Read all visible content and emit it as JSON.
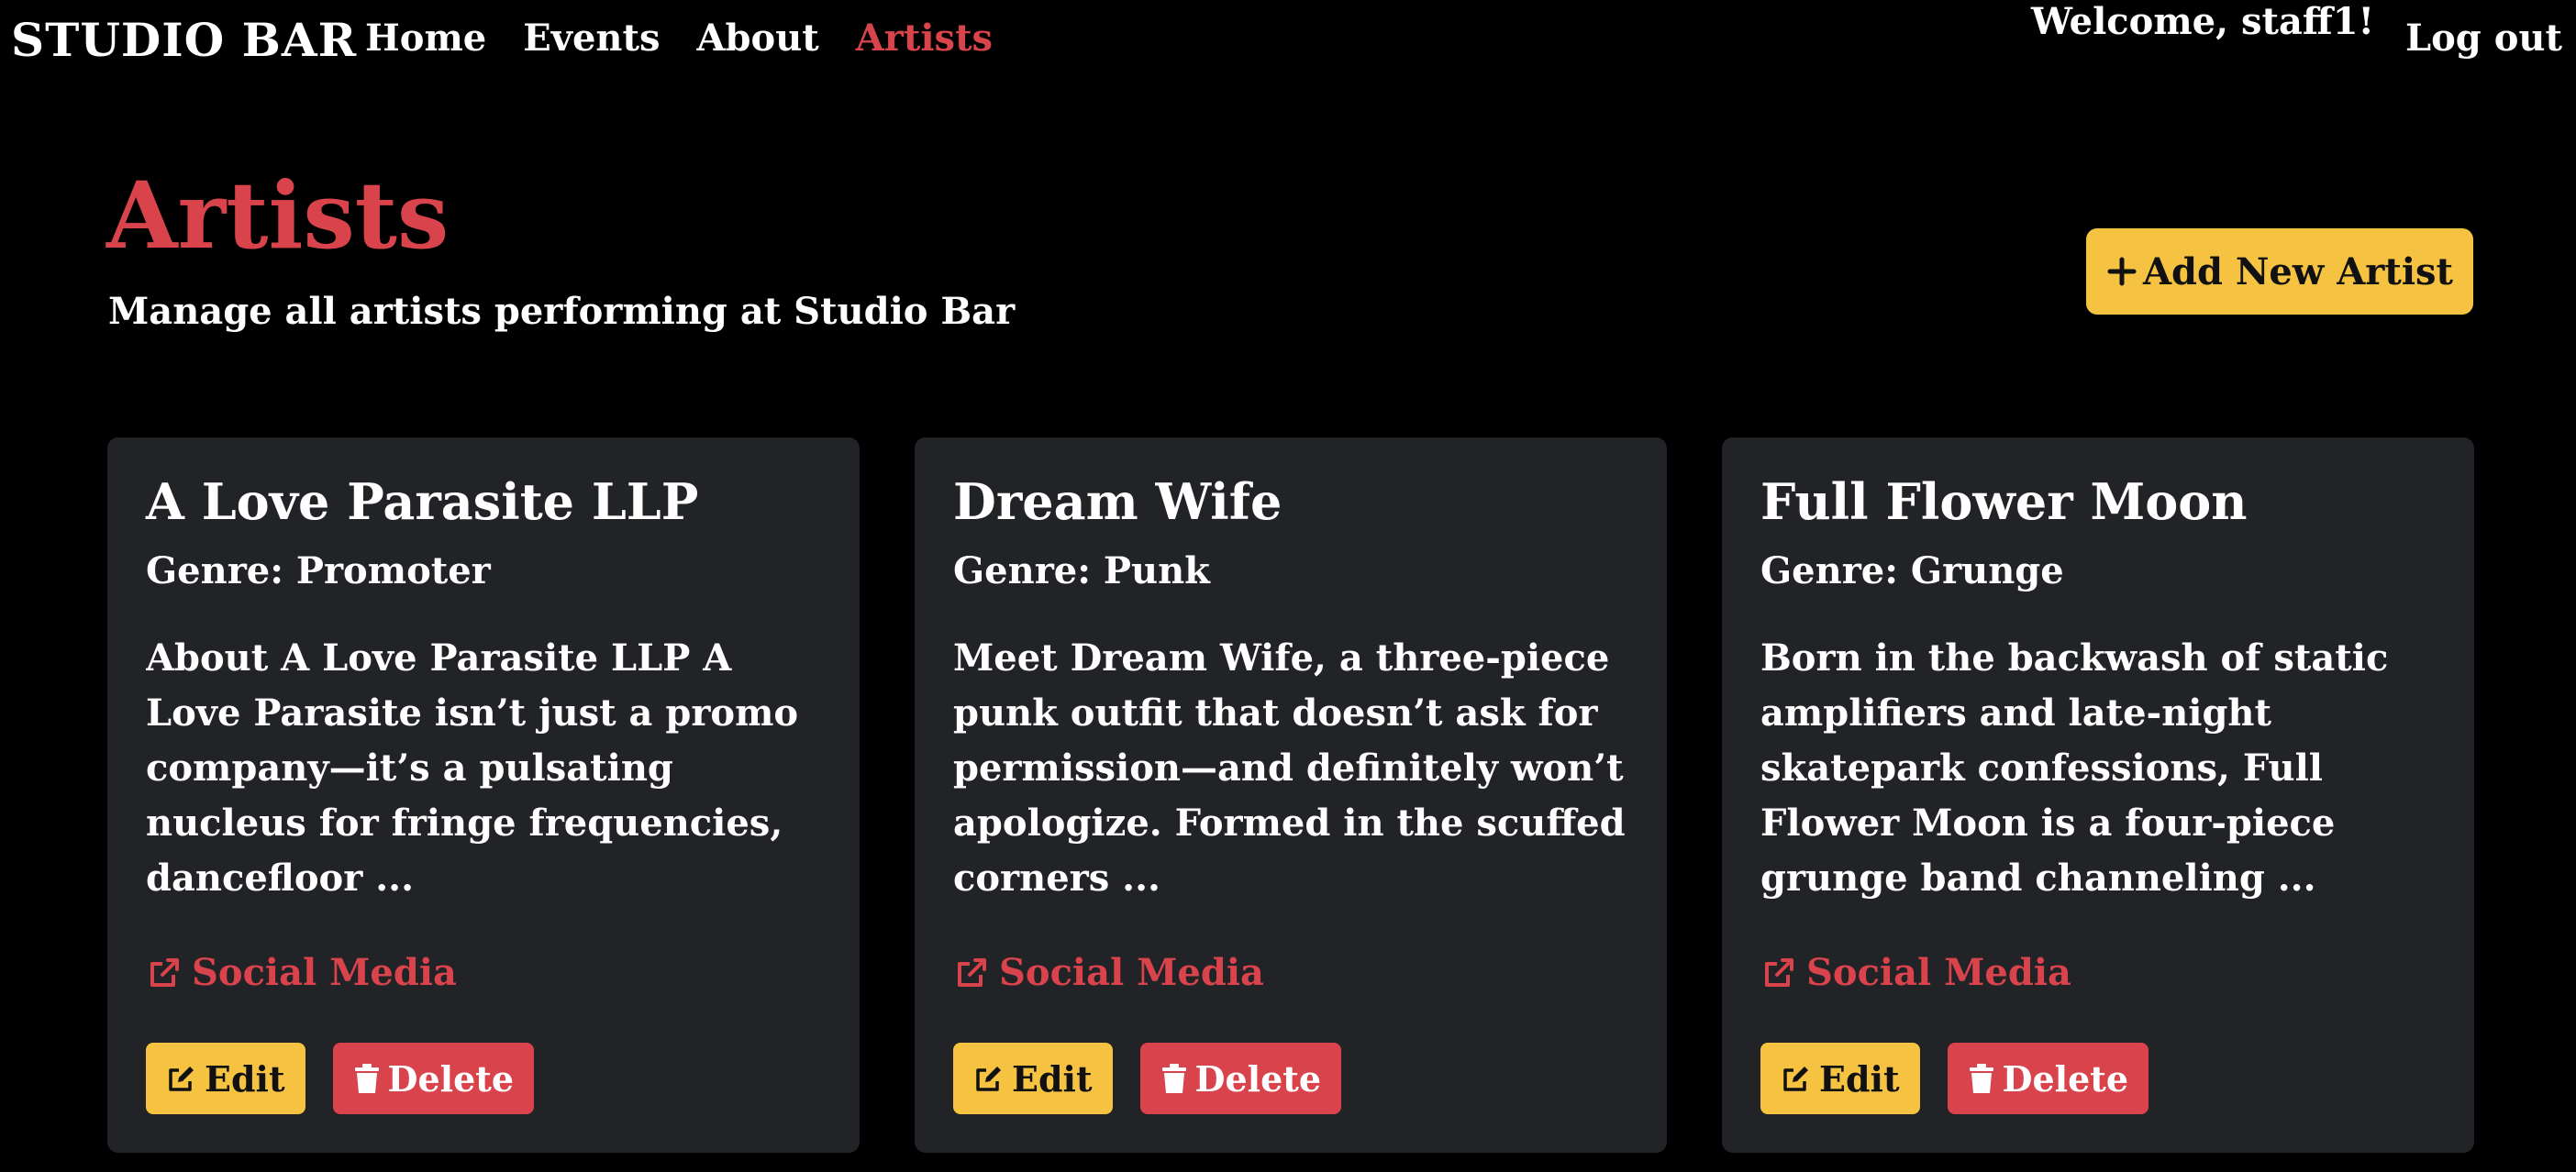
{
  "nav": {
    "brand": "STUDIO BAR",
    "links": [
      {
        "label": "Home"
      },
      {
        "label": "Events"
      },
      {
        "label": "About"
      },
      {
        "label": "Artists",
        "active": true
      }
    ],
    "welcome": "Welcome, staff1!",
    "logout": "Log out"
  },
  "header": {
    "title": "Artists",
    "subtitle": "Manage all artists performing at Studio Bar",
    "add_button": "Add New Artist",
    "add_icon": "+"
  },
  "artists": [
    {
      "name": "A Love Parasite LLP",
      "genre": "Genre: Promoter",
      "description": "About A Love Parasite LLP A Love Parasite isn’t just a promo company—it’s a pulsating nucleus for fringe frequencies, dancefloor ...",
      "social_label": "Social Media",
      "edit_label": "Edit",
      "delete_label": "Delete"
    },
    {
      "name": "Dream Wife",
      "genre": "Genre: Punk",
      "description": "Meet Dream Wife, a three-piece punk outfit that doesn’t ask for permission—and definitely won’t apologize. Formed in the scuffed corners ...",
      "social_label": "Social Media",
      "edit_label": "Edit",
      "delete_label": "Delete"
    },
    {
      "name": "Full Flower Moon",
      "genre": "Genre: Grunge",
      "description": "Born in the backwash of static amplifiers and late-night skatepark confessions, Full Flower Moon is a four-piece grunge band channeling ...",
      "social_label": "Social Media",
      "edit_label": "Edit",
      "delete_label": "Delete"
    }
  ],
  "icons": {
    "social": "external-link-icon",
    "edit": "edit-icon",
    "delete": "trash-icon"
  },
  "colors": {
    "accent_red": "#d9434b",
    "accent_yellow": "#f5c242",
    "card_bg": "#212327",
    "page_bg": "#000000"
  }
}
